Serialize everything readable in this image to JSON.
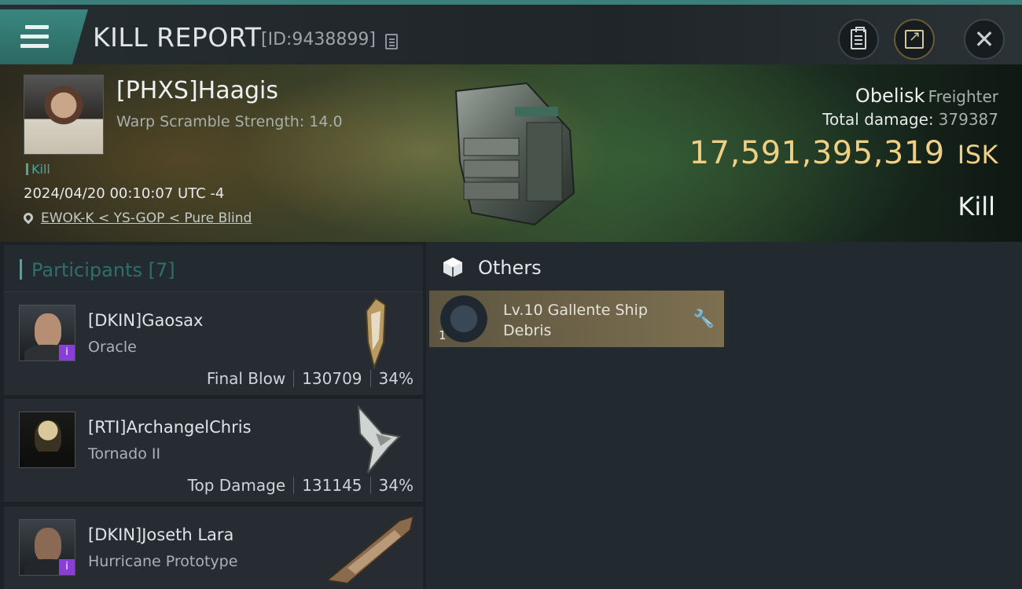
{
  "header": {
    "title": "KILL REPORT",
    "report_id": "[ID:9438899]",
    "icons": [
      "menu-icon",
      "copy-icon",
      "clipboard-icon",
      "share-icon",
      "close-icon"
    ]
  },
  "victim": {
    "name": "[PHXS]Haagis",
    "warp_scramble": "Warp Scramble Strength: 14.0",
    "tag": "Kill",
    "datetime": "2024/04/20 00:10:07 UTC -4",
    "location": "EWOK-K < YS-GOP < Pure Blind",
    "ship_name": "Obelisk",
    "ship_class": "Freighter",
    "total_damage_label": "Total damage:",
    "total_damage": "379387",
    "isk_value": "17,591,395,319",
    "isk_unit": "ISK",
    "result": "Kill"
  },
  "participants": {
    "title": "Participants [7]",
    "rows": [
      {
        "name": "[DKIN]Gaosax",
        "ship": "Oracle",
        "label": "Final Blow",
        "damage": "130709",
        "percent": "34%",
        "badge": "i"
      },
      {
        "name": "[RTI]ArchangelChris",
        "ship": "Tornado II",
        "label": "Top Damage",
        "damage": "131145",
        "percent": "34%",
        "badge": ""
      },
      {
        "name": "[DKIN]Joseth Lara",
        "ship": "Hurricane Prototype",
        "label": "",
        "damage": "",
        "percent": "",
        "badge": "i"
      }
    ]
  },
  "others": {
    "title": "Others",
    "items": [
      {
        "name": "Lv.10 Gallente Ship Debris",
        "qty": "1"
      }
    ]
  },
  "colors": {
    "accent_teal": "#3c7f7a",
    "isk_gold": "#efcf83",
    "item_card": "#7d7051",
    "badge_purple": "#8a3fd4"
  }
}
